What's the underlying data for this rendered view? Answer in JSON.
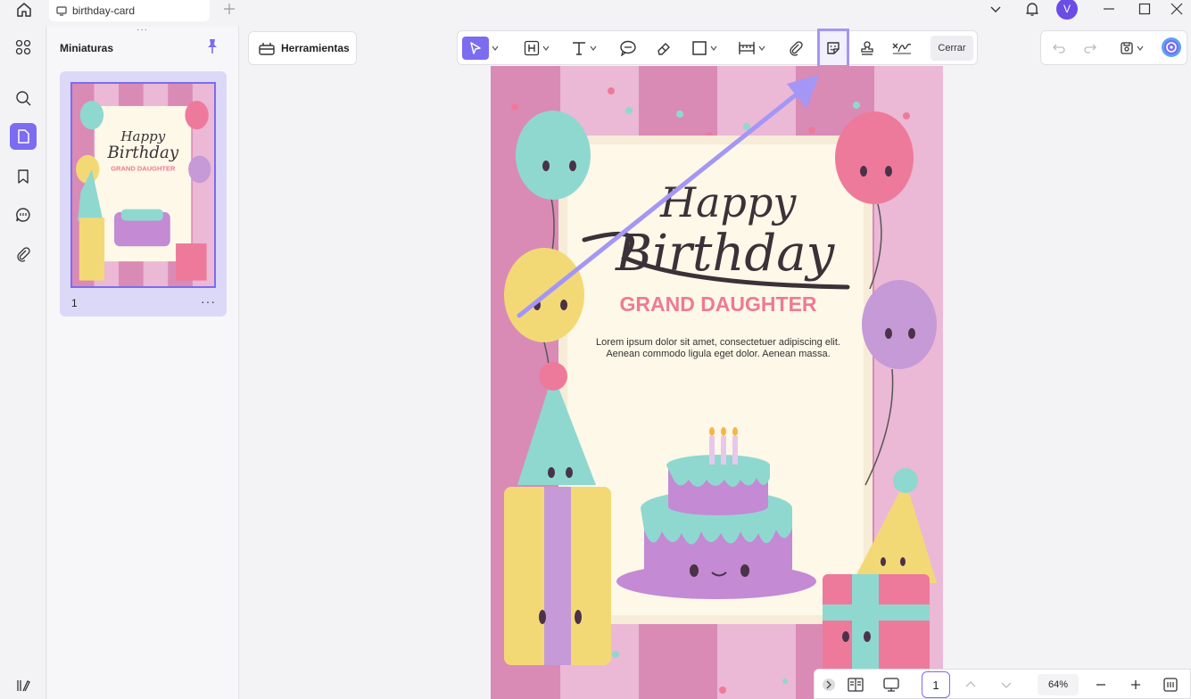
{
  "tab": {
    "title": "birthday-card"
  },
  "user": {
    "initial": "V"
  },
  "sidebar": {
    "title": "Miniaturas"
  },
  "thumbnail": {
    "page_number": "1",
    "more": "···"
  },
  "toolbar": {
    "tools_label": "Herramientas",
    "close_label": "Cerrar"
  },
  "card": {
    "happy": "Happy",
    "birthday": "Birthday",
    "subtitle": "GRAND DAUGHTER",
    "body_line1": "Lorem ipsum dolor sit amet, consectetuer adipiscing elit.",
    "body_line2": "Aenean commodo ligula eget dolor. Aenean massa."
  },
  "bottom": {
    "page": "1",
    "zoom": "64%"
  },
  "colors": {
    "accent": "#7b6cf0",
    "highlight": "#a496f5",
    "stripe_pink": "#ebb8d6",
    "stripe_dark": "#d98bb6",
    "cream": "#fdf8e8",
    "title_pink": "#ee7a93"
  }
}
